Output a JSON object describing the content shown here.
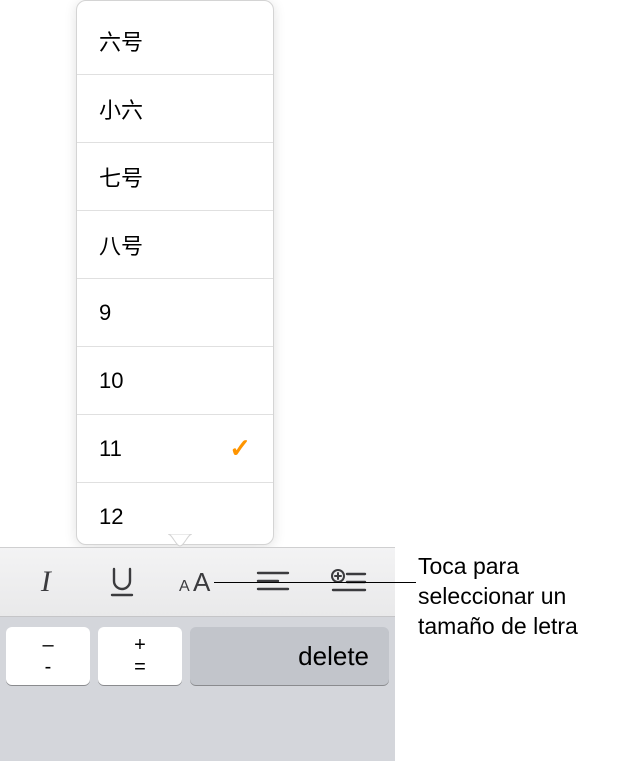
{
  "popover": {
    "items": [
      {
        "label": "六号",
        "selected": false
      },
      {
        "label": "小六",
        "selected": false
      },
      {
        "label": "七号",
        "selected": false
      },
      {
        "label": "八号",
        "selected": false
      },
      {
        "label": "9",
        "selected": false
      },
      {
        "label": "10",
        "selected": false
      },
      {
        "label": "11",
        "selected": true
      },
      {
        "label": "12",
        "selected": false
      }
    ],
    "checkmark": "✓"
  },
  "toolbar": {
    "italic": "I"
  },
  "keyboard": {
    "minus_top": "–",
    "minus_bot": "-",
    "plus_top": "+",
    "plus_bot": "=",
    "delete": "delete"
  },
  "callout": {
    "text": "Toca para seleccionar un tamaño de letra"
  }
}
